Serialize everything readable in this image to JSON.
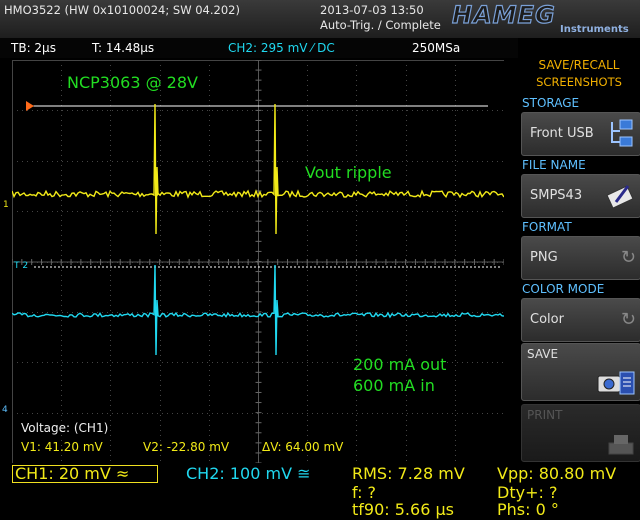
{
  "header": {
    "model": "HMO3522 (HW 0x10100024; SW 04.202)",
    "date": "2013-07-03 13:50",
    "trigger_status": "Auto-Trig. / Complete",
    "brand": "HAMEG",
    "brand_sub": "Instruments"
  },
  "infobar": {
    "timebase": "TB: 2µs",
    "trigger_time": "T: 14.48µs",
    "ch2_trigger": "CH2: 295 mV ⁄ DC",
    "sample_rate": "250MSa"
  },
  "screen": {
    "title": "NCP3063 @ 28V",
    "ripple_label": "Vout ripple",
    "load_out": "200 mA out",
    "load_in": "600 mA in",
    "cursor_measurement": "Voltage: (CH1)",
    "v1": "V1: 41.20 mV",
    "v2": "V2: -22.80 mV",
    "dv": "ΔV: 64.00 mV",
    "ch1_marker": "1",
    "ch2_marker": "T 2",
    "ch4_marker": "4"
  },
  "colors": {
    "ch1": "#f2ea18",
    "ch2": "#20d8f0",
    "annotation": "#22dd22",
    "menu_title": "#f2b000",
    "menu_label": "#5fc0ff"
  },
  "channels": {
    "ch1": "CH1: 20 mV ≈",
    "ch2": "CH2: 100 mV ≅"
  },
  "measurements": {
    "rms": "RMS: 7.28 mV",
    "freq": "f: ?",
    "tf90": "tf90: 5.66 µs",
    "vpp": "Vpp: 80.80 mV",
    "duty": "Dty+: ?",
    "phase": "Phs: 0 °"
  },
  "menu": {
    "title_line1": "SAVE/RECALL",
    "title_line2": "SCREENSHOTS",
    "storage_label": "STORAGE",
    "storage_value": "Front USB",
    "filename_label": "FILE NAME",
    "filename_value": "SMPS43",
    "format_label": "FORMAT",
    "format_value": "PNG",
    "colormode_label": "COLOR MODE",
    "colormode_value": "Color",
    "save_label": "SAVE",
    "print_label": "PRINT"
  },
  "icons": {
    "storage": "usb-folder-icon",
    "filename": "keyboard-pen-icon",
    "save": "camera-save-icon",
    "print": "printer-icon"
  }
}
